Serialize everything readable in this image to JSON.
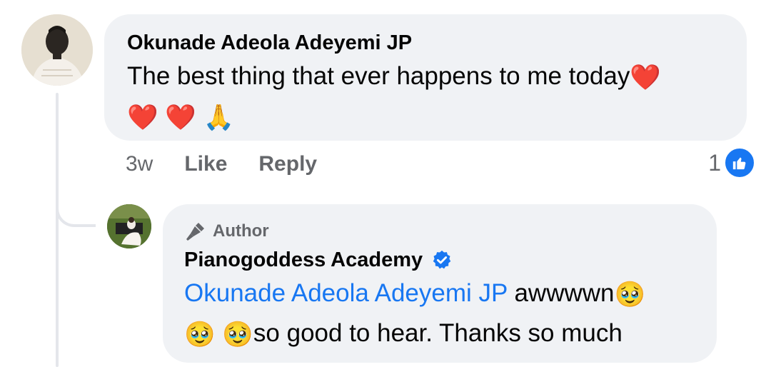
{
  "comment": {
    "author": "Okunade Adeola Adeyemi JP",
    "text_line1": "The best thing that ever happens to me today",
    "emoji_line1": "❤️",
    "emoji_line2": [
      "❤️",
      "❤️",
      "🙏"
    ],
    "time": "3w",
    "like_label": "Like",
    "reply_label": "Reply",
    "reaction_count": "1",
    "reaction_icon": "like-thumb-icon"
  },
  "reply": {
    "badge_label": "Author",
    "badge_icon": "microphone-icon",
    "author": "Pianogoddess Academy",
    "verified": true,
    "mention": "Okunade Adeola Adeyemi JP",
    "text_part1": " awwwwn",
    "text_part2": "so good to hear. Thanks so much",
    "emoji": "🥹"
  },
  "colors": {
    "bubble": "#f0f2f5",
    "link": "#1877f2",
    "meta": "#65676b"
  }
}
